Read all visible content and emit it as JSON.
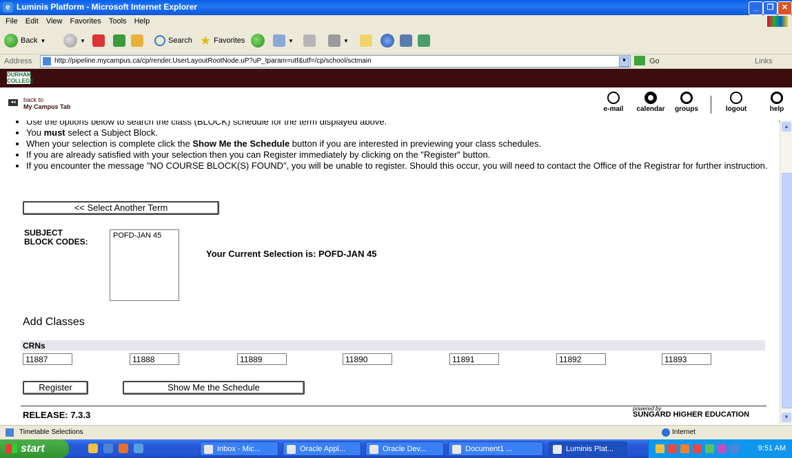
{
  "window": {
    "title": "Luminis Platform - Microsoft Internet Explorer",
    "icon": "ie-icon"
  },
  "menu": [
    "File",
    "Edit",
    "View",
    "Favorites",
    "Tools",
    "Help"
  ],
  "toolbar": {
    "back": "Back",
    "search": "Search",
    "favorites": "Favorites"
  },
  "address": {
    "label": "Address",
    "url": "http://pipeline.mycampus.ca/cp/render.UserLayoutRootNode.uP?uP_tparam=utf&utf=/cp/school/sctmain",
    "go": "Go",
    "links": "Links"
  },
  "brand": {
    "logo": "DURHAM COLLEGE"
  },
  "nav": {
    "back_line1": "back to",
    "back_line2": "My Campus Tab",
    "items": [
      {
        "label": "e-mail",
        "icon": "email-icon"
      },
      {
        "label": "calendar",
        "icon": "calendar-icon"
      },
      {
        "label": "groups",
        "icon": "groups-icon"
      },
      {
        "label": "logout",
        "icon": "logout-icon"
      },
      {
        "label": "help",
        "icon": "help-icon"
      }
    ]
  },
  "instructions": {
    "line0": "Use the options below to search the class (BLOCK) schedule for the term displayed above.",
    "line1_pre": "You ",
    "line1_bold": "must",
    "line1_post": " select a Subject Block.",
    "line2_pre": "When your selection is complete click the ",
    "line2_bold": "Show Me the Schedule",
    "line2_post": " button if you are interested in previewing your class schedules.",
    "line3": "If you are already satisfied with your selection then you can Register immediately by clicking on the \"Register\" button.",
    "line4": "If you encounter the message \"NO COURSE BLOCK(S) FOUND\", you will be unable to register. Should this occur, you will need to contact the Office of the Registrar for further instruction."
  },
  "select_term_button": "<< Select Another Term",
  "subject": {
    "label_line1": "SUBJECT",
    "label_line2": "BLOCK CODES:",
    "options": [
      "POFD-JAN 45"
    ],
    "current_selection": "Your Current Selection is: POFD-JAN 45"
  },
  "add_classes": {
    "heading": "Add Classes",
    "crn_header": "CRNs",
    "crns": [
      "11887",
      "11888",
      "11889",
      "11890",
      "11891",
      "11892",
      "11893"
    ]
  },
  "buttons": {
    "register": "Register",
    "show_schedule": "Show Me the Schedule"
  },
  "footer": {
    "release": "RELEASE: 7.3.3",
    "powered_by": "powered by",
    "vendor": "SUNGARD",
    "vendor_rest": " HIGHER EDUCATION"
  },
  "status": {
    "text": "Timetable Selections",
    "zone": "Internet"
  },
  "taskbar": {
    "start": "start",
    "tasks": [
      {
        "label": "Inbox - Mic...",
        "active": false
      },
      {
        "label": "Oracle Appl...",
        "active": false
      },
      {
        "label": "Oracle Dev...",
        "active": false
      },
      {
        "label": "Document1 ...",
        "active": false
      },
      {
        "label": "Luminis Plat...",
        "active": true
      }
    ],
    "clock": "9:51 AM"
  },
  "colors": {
    "brand_band": "#3d0d0d",
    "xp_blue": "#2456d4",
    "start_green": "#3a9e3a"
  }
}
